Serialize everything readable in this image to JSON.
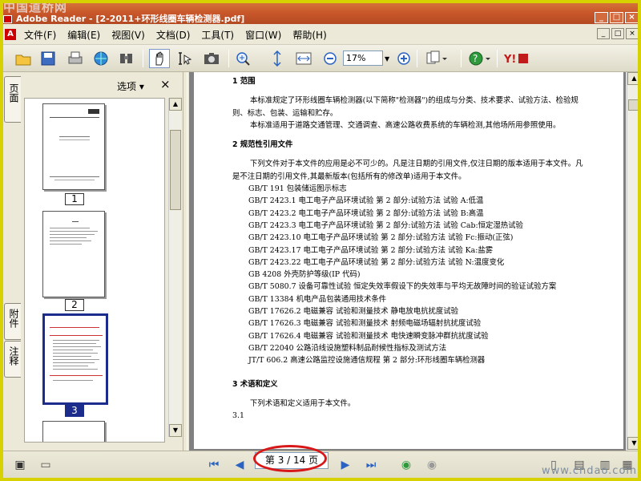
{
  "window": {
    "watermark": "中国道桥网",
    "title": "Adobe Reader - [2-2011+环形线圈车辆检测器.pdf]",
    "buttons": [
      "_",
      "□",
      "×"
    ]
  },
  "menu": {
    "items": [
      "文件(F)",
      "编辑(E)",
      "视图(V)",
      "文档(D)",
      "工具(T)",
      "窗口(W)",
      "帮助(H)"
    ],
    "mdi_buttons": [
      "_",
      "□",
      "×"
    ]
  },
  "toolbar": {
    "zoom_value": "17%",
    "icons": [
      "open-folder-icon",
      "save-icon",
      "print-icon",
      "email-icon",
      "search-icon",
      "hand-tool-icon",
      "select-text-icon",
      "snapshot-icon",
      "zoom-in-tool-icon",
      "fit-page-icon",
      "fit-width-icon",
      "zoom-out-icon",
      "zoom-plus-icon",
      "pages-icon",
      "help-icon",
      "yahoo-icon"
    ]
  },
  "nav_panel": {
    "options_label": "选项 ▾",
    "close_label": "×",
    "side_tabs": [
      "页面",
      "附件",
      "注释"
    ],
    "thumbnails": [
      {
        "number": "1",
        "selected": false
      },
      {
        "number": "2",
        "selected": false
      },
      {
        "number": "3",
        "selected": true
      }
    ]
  },
  "document": {
    "sections": [
      {
        "heading": "1  范围"
      },
      {
        "para": "本标准规定了环形线圈车辆检测器(以下简称\"检测器\")的组成与分类、技术要求、试验方法、检验规则、标志、包装、运输和贮存。"
      },
      {
        "para": "本标准适用于道路交通管理、交通调查、高速公路收费系统的车辆检测,其他场所用参照使用。"
      },
      {
        "heading": "2  规范性引用文件"
      },
      {
        "para": "下列文件对于本文件的应用是必不可少的。凡是注日期的引用文件,仅注日期的版本适用于本文件。凡是不注日期的引用文件,其最新版本(包括所有的修改单)适用于本文件。"
      }
    ],
    "references": [
      "GB/T 191   包装储运图示标志",
      "GB/T 2423.1   电工电子产品环境试验   第 2 部分:试验方法   试验 A:低温",
      "GB/T 2423.2   电工电子产品环境试验   第 2 部分:试验方法   试验 B:高温",
      "GB/T 2423.3   电工电子产品环境试验   第 2 部分:试验方法   试验 Cab:恒定湿热试验",
      "GB/T 2423.10   电工电子产品环境试验   第 2 部分:试验方法   试验 Fc:振动(正弦)",
      "GB/T 2423.17   电工电子产品环境试验   第 2 部分:试验方法   试验 Ka:盐雾",
      "GB/T 2423.22   电工电子产品环境试验   第 2 部分:试验方法   试验 N:温度变化",
      "GB 4208   外壳防护等级(IP 代码)",
      "GB/T 5080.7   设备可靠性试验   恒定失效率假设下的失效率与平均无故障时间的验证试验方案",
      "GB/T 13384   机电产品包装通用技术条件",
      "GB/T 17626.2   电磁兼容   试验和测量技术   静电放电抗扰度试验",
      "GB/T 17626.3   电磁兼容   试验和测量技术   射频电磁场辐射抗扰度试验",
      "GB/T 17626.4   电磁兼容   试验和测量技术   电快速瞬变脉冲群抗扰度试验",
      "GB/T 22040   公路沿线设施塑料制品耐候性指标及测试方法",
      "JT/T 606.2   高速公路监控设施通信规程   第 2 部分:环形线圈车辆检测器"
    ],
    "section3_heading": "3  术语和定义",
    "section3_para": "下列术语和定义适用于本文件。",
    "last_line": "3.1"
  },
  "statusbar": {
    "page_indicator": "第 3 / 14 页",
    "watermark": "www.cndao.com"
  }
}
